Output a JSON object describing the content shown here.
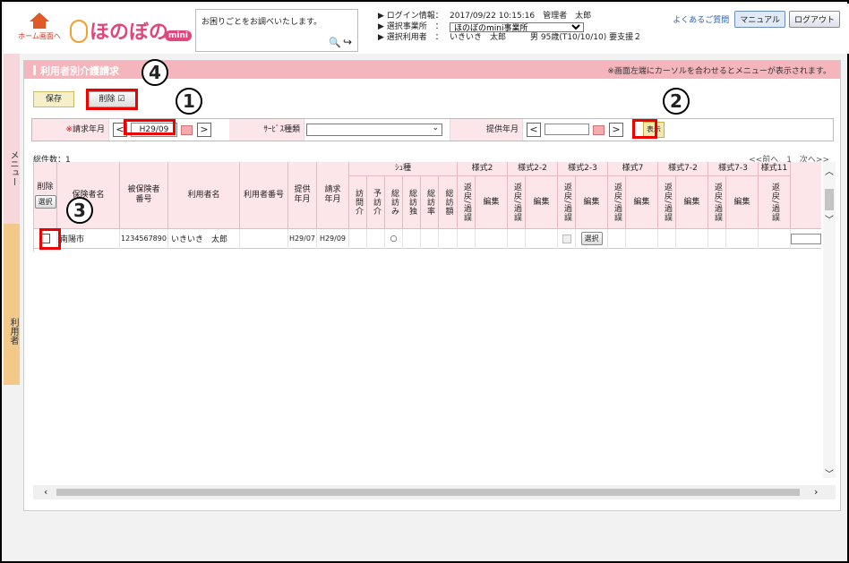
{
  "header": {
    "home_label": "ホーム画面へ",
    "logo_text": "ほのぼの",
    "logo_badge": "mini",
    "help_text": "お困りごとをお調べいたします。",
    "login_label": "▶ ログイン情報：",
    "login_value": "2017/09/22 10:15:16　管理者　太郎",
    "office_label": "▶ 選択事業所　：",
    "office_value": "ほのぼのmini事業所",
    "user_label": "▶ 選択利用者　：",
    "user_value": "いきいき　太郎　　　男 95歳(T10/10/10) 要支援２",
    "faq_link": "よくあるご質問",
    "manual_button": "マニュアル",
    "logout_button": "ログアウト"
  },
  "side": {
    "menu_tab": "メニュー",
    "user_tab": "利用者"
  },
  "panel": {
    "title": "利用者別介護請求",
    "note": "※画面左端にカーソルを合わせるとメニューが表示されます。",
    "save_button": "保存",
    "delete_button": "削除",
    "delete_check": "☑"
  },
  "filter": {
    "req_month_label": "請求年月",
    "req_required_mark": "※",
    "req_month_value": "H29/09",
    "service_type_label": "ｻｰﾋﾞｽ種類",
    "service_type_value": "",
    "provide_month_label": "提供年月",
    "provide_month_value": "",
    "display_button": "表示",
    "prev": "<",
    "next": ">"
  },
  "list": {
    "count": "総件数：1",
    "pager": "<<前へ　1　次へ>>",
    "headers": {
      "delete": "削除",
      "select": "選択",
      "insurer": "保険者名",
      "insured_no": "被保険者番号",
      "user_name": "利用者名",
      "user_no": "利用者番号",
      "provide_ym": "提供年月",
      "request_ym": "請求年月",
      "kind": "ｼｭ種",
      "kind_cols": [
        "訪問介",
        "予訪介",
        "総訪み",
        "総訪独",
        "総訪率",
        "総訪額"
      ],
      "form_groups": [
        "様式2",
        "様式2-2",
        "様式2-3",
        "様式7",
        "様式7-2",
        "様式7-3",
        "様式11"
      ],
      "sub_return": "返戻/過誤",
      "sub_edit": "編集"
    },
    "rows": [
      {
        "insurer": "南陽市",
        "insured_no": "1234567890",
        "user_name": "いきいき　太郎",
        "user_no": "",
        "provide_ym": "H29/07",
        "request_ym": "H29/09",
        "mark": "○",
        "select_btn": "選択"
      }
    ]
  },
  "callouts": [
    "1",
    "2",
    "3",
    "4"
  ]
}
